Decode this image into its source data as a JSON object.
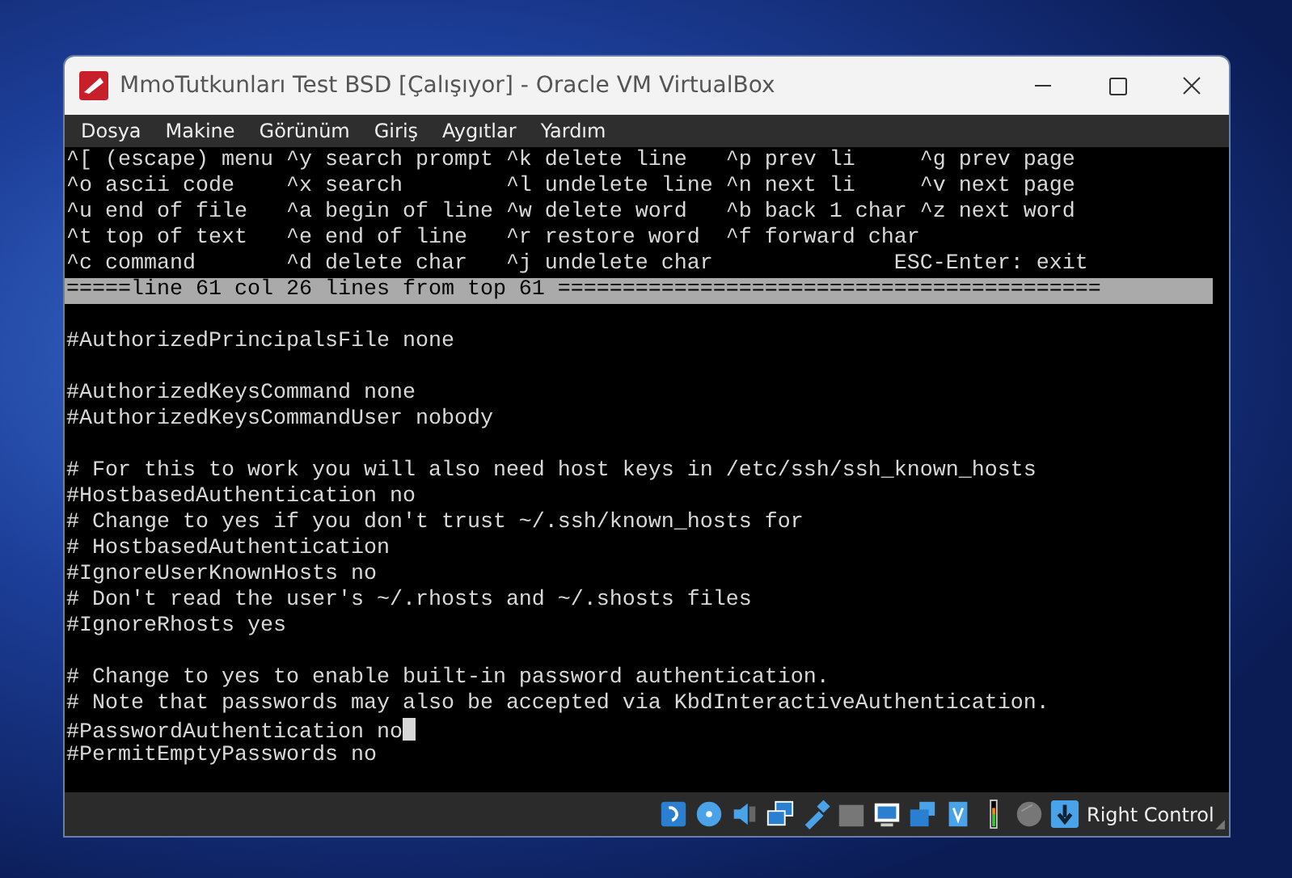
{
  "window": {
    "title": "MmoTutkunları Test BSD [Çalışıyor] - Oracle VM VirtualBox"
  },
  "menu": [
    "Dosya",
    "Makine",
    "Görünüm",
    "Giriş",
    "Aygıtlar",
    "Yardım"
  ],
  "terminal": {
    "help_rows": [
      "^[ (escape) menu ^y search prompt ^k delete line   ^p prev li     ^g prev page",
      "^o ascii code    ^x search        ^l undelete line ^n next li     ^v next page",
      "^u end of file   ^a begin of line ^w delete word   ^b back 1 char ^z next word",
      "^t top of text   ^e end of line   ^r restore word  ^f forward char",
      "^c command       ^d delete char   ^j undelete char              ESC-Enter: exit"
    ],
    "status_line": "=====line 61 col 26 lines from top 61 ==========================================",
    "lines": [
      {
        "kind": "blank"
      },
      {
        "kind": "text",
        "text": "#AuthorizedPrincipalsFile none",
        "cursor": false
      },
      {
        "kind": "blank"
      },
      {
        "kind": "text",
        "text": "#AuthorizedKeysCommand none",
        "cursor": false
      },
      {
        "kind": "text",
        "text": "#AuthorizedKeysCommandUser nobody",
        "cursor": false
      },
      {
        "kind": "blank"
      },
      {
        "kind": "text",
        "text": "# For this to work you will also need host keys in /etc/ssh/ssh_known_hosts",
        "cursor": false
      },
      {
        "kind": "text",
        "text": "#HostbasedAuthentication no",
        "cursor": false
      },
      {
        "kind": "text",
        "text": "# Change to yes if you don't trust ~/.ssh/known_hosts for",
        "cursor": false
      },
      {
        "kind": "text",
        "text": "# HostbasedAuthentication",
        "cursor": false
      },
      {
        "kind": "text",
        "text": "#IgnoreUserKnownHosts no",
        "cursor": false
      },
      {
        "kind": "text",
        "text": "# Don't read the user's ~/.rhosts and ~/.shosts files",
        "cursor": false
      },
      {
        "kind": "text",
        "text": "#IgnoreRhosts yes",
        "cursor": false
      },
      {
        "kind": "blank"
      },
      {
        "kind": "text",
        "text": "# Change to yes to enable built-in password authentication.",
        "cursor": false
      },
      {
        "kind": "text",
        "text": "# Note that passwords may also be accepted via KbdInteractiveAuthentication.",
        "cursor": false
      },
      {
        "kind": "text",
        "text": "#PasswordAuthentication no",
        "cursor": true
      },
      {
        "kind": "text",
        "text": "#PermitEmptyPasswords no",
        "cursor": false
      }
    ]
  },
  "status_bar": {
    "host_key": "Right Control"
  }
}
